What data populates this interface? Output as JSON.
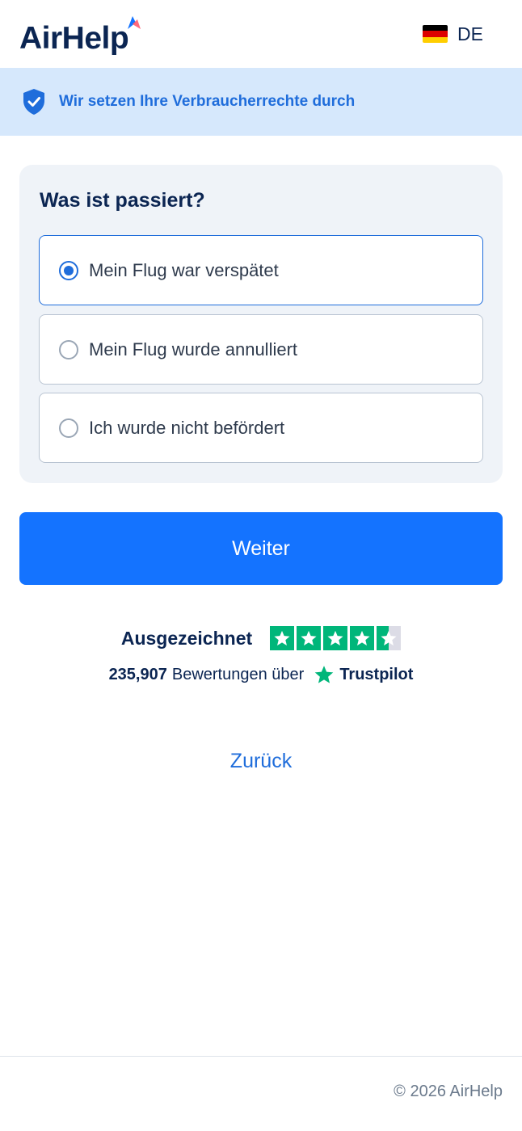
{
  "header": {
    "logo_text": "AirHelp",
    "language": {
      "code": "DE",
      "flag": "germany-flag-icon",
      "flag_colors": [
        "#000000",
        "#dd0000",
        "#ffce00"
      ]
    }
  },
  "banner": {
    "icon": "shield-check-icon",
    "text": "Wir setzen Ihre Verbraucherrechte durch"
  },
  "form": {
    "title": "Was ist passiert?",
    "options": [
      {
        "label": "Mein Flug war verspätet",
        "selected": true
      },
      {
        "label": "Mein Flug wurde annulliert",
        "selected": false
      },
      {
        "label": "Ich wurde nicht befördert",
        "selected": false
      }
    ]
  },
  "continue_label": "Weiter",
  "trustpilot": {
    "rating_text": "Ausgezeichnet",
    "stars": 4.5,
    "review_count": "235,907",
    "reviews_text": "Bewertungen über",
    "brand": "Trustpilot"
  },
  "back_label": "Zurück",
  "footer": {
    "copyright": "© 2026 AirHelp"
  },
  "colors": {
    "primary": "#1473ff",
    "accent_text": "#1f6ddb",
    "navy": "#0b2552",
    "banner_bg": "#d6e8fc",
    "card_bg": "#eff3f8",
    "trustpilot_green": "#00b67a"
  }
}
